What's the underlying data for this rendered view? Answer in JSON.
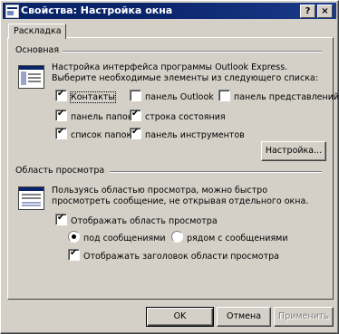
{
  "window": {
    "title": "Свойства: Настройка окна"
  },
  "titlebar_buttons": {
    "help": "?",
    "close": "×"
  },
  "tab": {
    "label": "Раскладка"
  },
  "basic": {
    "title": "Основная",
    "description": "Настройка интерфейса программы Outlook Express. Выберите необходимые элементы из следующего списка:",
    "checkboxes": [
      {
        "label": "Контакты",
        "checked": true
      },
      {
        "label": "панель Outlook",
        "checked": false
      },
      {
        "label": "панель представлений",
        "checked": false
      },
      {
        "label": "панель папок",
        "checked": true
      },
      {
        "label": "строка состояния",
        "checked": true
      },
      {
        "label": "список папок",
        "checked": true
      },
      {
        "label": "панель инструментов",
        "checked": true
      }
    ],
    "customize_button": "Настройка..."
  },
  "preview": {
    "title": "Область просмотра",
    "description": "Пользуясь областью просмотра, можно быстро просмотреть сообщение, не открывая отдельного окна.",
    "show_checkbox": {
      "label": "Отображать область просмотра",
      "checked": true
    },
    "radios": [
      {
        "label": "под сообщениями",
        "selected": true
      },
      {
        "label": "рядом с сообщениями",
        "selected": false
      }
    ],
    "header_checkbox": {
      "label": "Отображать заголовок области просмотра",
      "checked": true
    }
  },
  "footer": {
    "ok": "OK",
    "cancel": "Отмена",
    "apply": "Применить"
  }
}
